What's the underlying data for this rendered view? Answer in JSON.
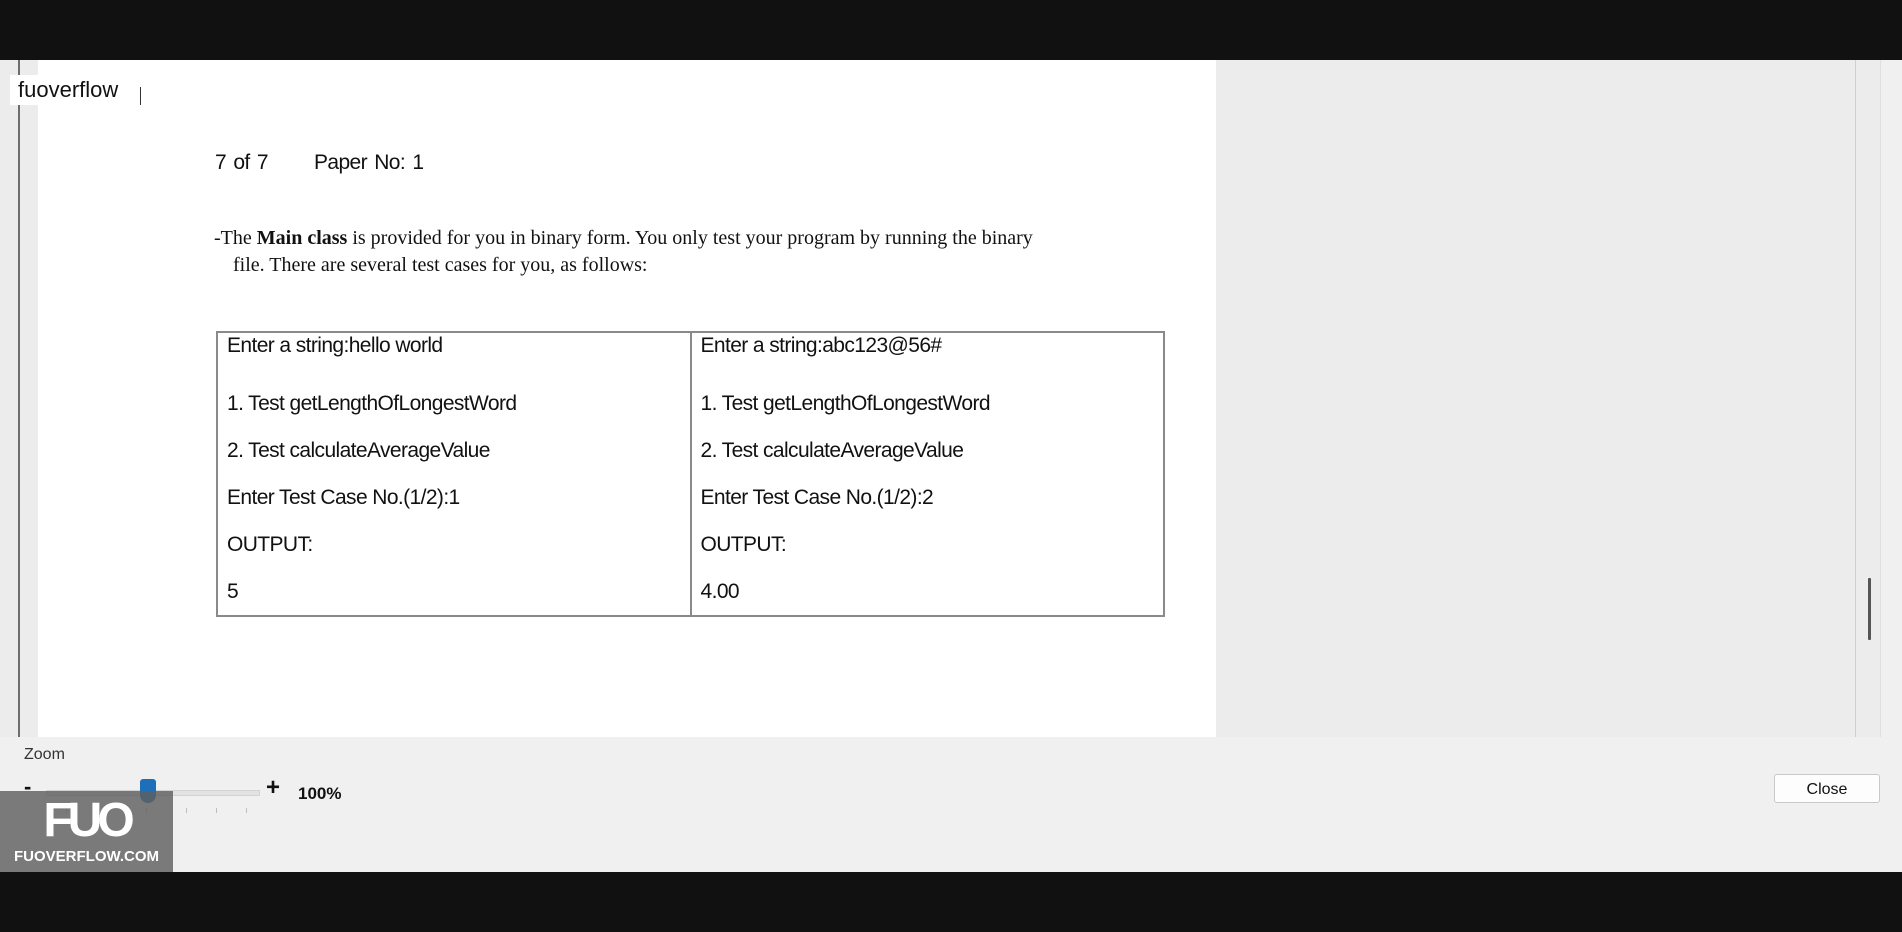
{
  "name_box": {
    "text": "fuoverflow"
  },
  "document": {
    "page_indicator": "7 of 7",
    "paper_no": "Paper No: 1",
    "description": {
      "prefix": "-The ",
      "bold": "Main class",
      "rest_line1": " is provided for you in binary form. You only test your program by running the binary",
      "line2": "file. There are several test cases for you, as follows:"
    },
    "test_cases": [
      {
        "lines": [
          "Enter a string:hello world",
          "1. Test getLengthOfLongestWord",
          "2. Test calculateAverageValue",
          "Enter Test Case No.(1/2):1",
          "OUTPUT:",
          "5"
        ]
      },
      {
        "lines": [
          "Enter a string:abc123@56#",
          "1. Test getLengthOfLongestWord",
          "2. Test calculateAverageValue",
          "Enter Test Case No.(1/2):2",
          "OUTPUT:",
          "4.00"
        ]
      }
    ]
  },
  "zoom": {
    "label": "Zoom",
    "minus": "-",
    "plus": "+",
    "value_text": "100%",
    "slider_fraction": 0.48
  },
  "close_button": {
    "label": "Close"
  },
  "watermark": {
    "logo": "FUO",
    "site": "FUOVERFLOW.COM"
  },
  "colors": {
    "zoom_thumb": "#1f6fb8",
    "background": "#111111",
    "panel": "#f0f0f0"
  }
}
